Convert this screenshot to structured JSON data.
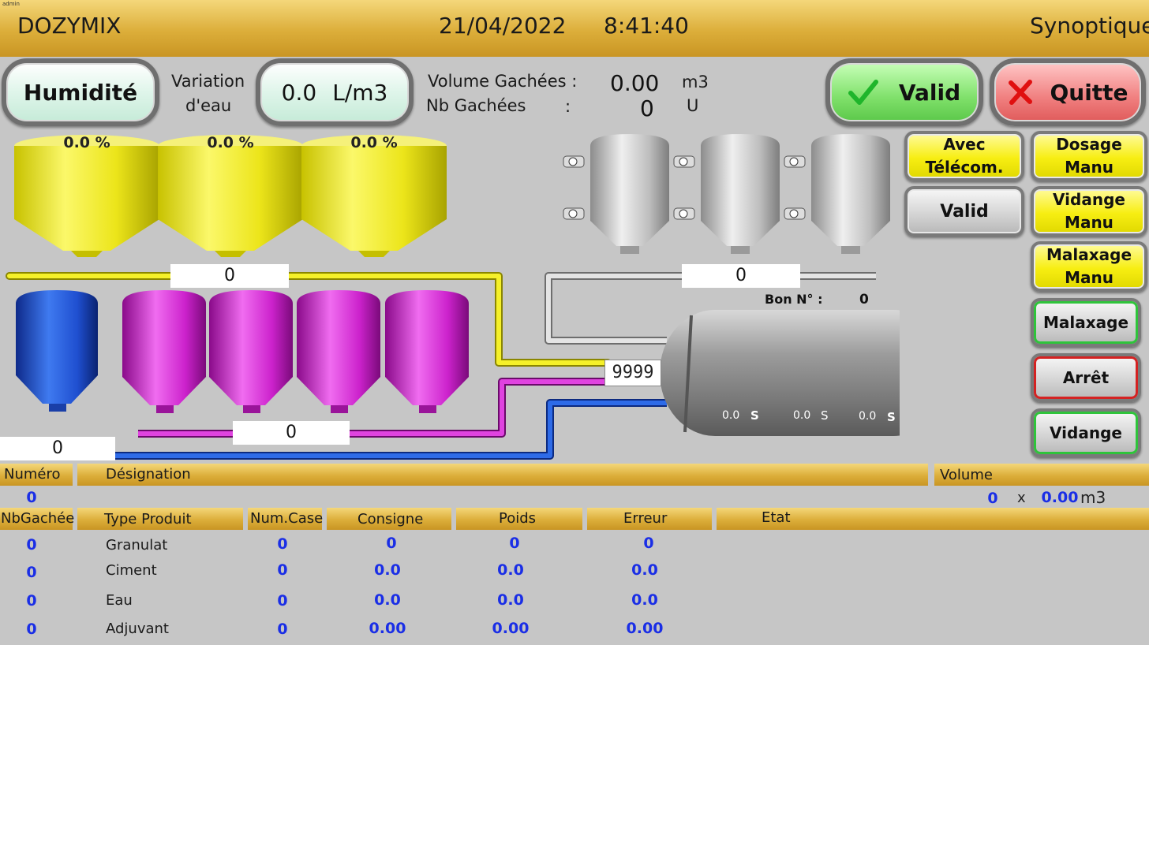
{
  "header": {
    "user": "admin",
    "app_title": "DOZYMIX",
    "date": "21/04/2022",
    "time": "8:41:40",
    "screen_name": "Synoptique"
  },
  "controls": {
    "humidite_label": "Humidité",
    "variation_line1": "Variation",
    "variation_line2": "d'eau",
    "variation_value": "0.0",
    "variation_unit": "L/m3",
    "volume_label": "Volume Gachées :",
    "volume_value": "0.00",
    "volume_unit": "m3",
    "nb_label": "Nb Gachées",
    "nb_colon": ":",
    "nb_value": "0",
    "nb_unit": "U",
    "valid_label": "Valid",
    "quitte_label": "Quitte"
  },
  "side_buttons": {
    "telecom_line1": "Avec",
    "telecom_line2": "Télécom.",
    "dosage_line1": "Dosage",
    "dosage_line2": "Manu",
    "valid": "Valid",
    "vidange_manu_line1": "Vidange",
    "vidange_manu_line2": "Manu",
    "malaxage_manu_line1": "Malaxage",
    "malaxage_manu_line2": "Manu",
    "malaxage": "Malaxage",
    "arret": "Arrêt",
    "vidange": "Vidange"
  },
  "synoptic": {
    "aggregate_silos": [
      {
        "pct": "0.0 %",
        "level": 0
      },
      {
        "pct": "0.0 %",
        "level": 0
      },
      {
        "pct": "0.0 %",
        "level": 0
      }
    ],
    "aggregate_scale": "0",
    "cement_scale": "0",
    "water_scale": "0",
    "additive_scale": "0",
    "bon_label": "Bon N° :",
    "bon_value": "0",
    "mixer_counter": "9999",
    "mixer_timers": [
      {
        "value": "0.0",
        "unit": "S"
      },
      {
        "value": "0.0",
        "unit": "S"
      },
      {
        "value": "0.0",
        "unit": "S"
      }
    ],
    "colors": {
      "aggregate": "#f2ec17",
      "water": "#1f53d6",
      "additive": "#cc22cc",
      "cement": "#b0b0b0"
    }
  },
  "order": {
    "headers": {
      "numero": "Numéro",
      "designation": "Désignation",
      "volume": "Volume"
    },
    "numero": "0",
    "volume_count": "0",
    "volume_times": "x",
    "volume_value": "0.00",
    "volume_unit": "m3"
  },
  "dosing_table": {
    "columns": [
      "NbGachée",
      "Type Produit",
      "Num.Case",
      "Consigne",
      "Poids",
      "Erreur",
      "Etat"
    ],
    "rows": [
      {
        "nb": "0",
        "type": "Granulat",
        "case": "0",
        "consigne": "0",
        "poids": "0",
        "erreur": "0"
      },
      {
        "nb": "0",
        "type": "Ciment",
        "case": "0",
        "consigne": "0.0",
        "poids": "0.0",
        "erreur": "0.0"
      },
      {
        "nb": "0",
        "type": "Eau",
        "case": "0",
        "consigne": "0.0",
        "poids": "0.0",
        "erreur": "0.0"
      },
      {
        "nb": "0",
        "type": "Adjuvant",
        "case": "0",
        "consigne": "0.00",
        "poids": "0.00",
        "erreur": "0.00"
      }
    ]
  }
}
